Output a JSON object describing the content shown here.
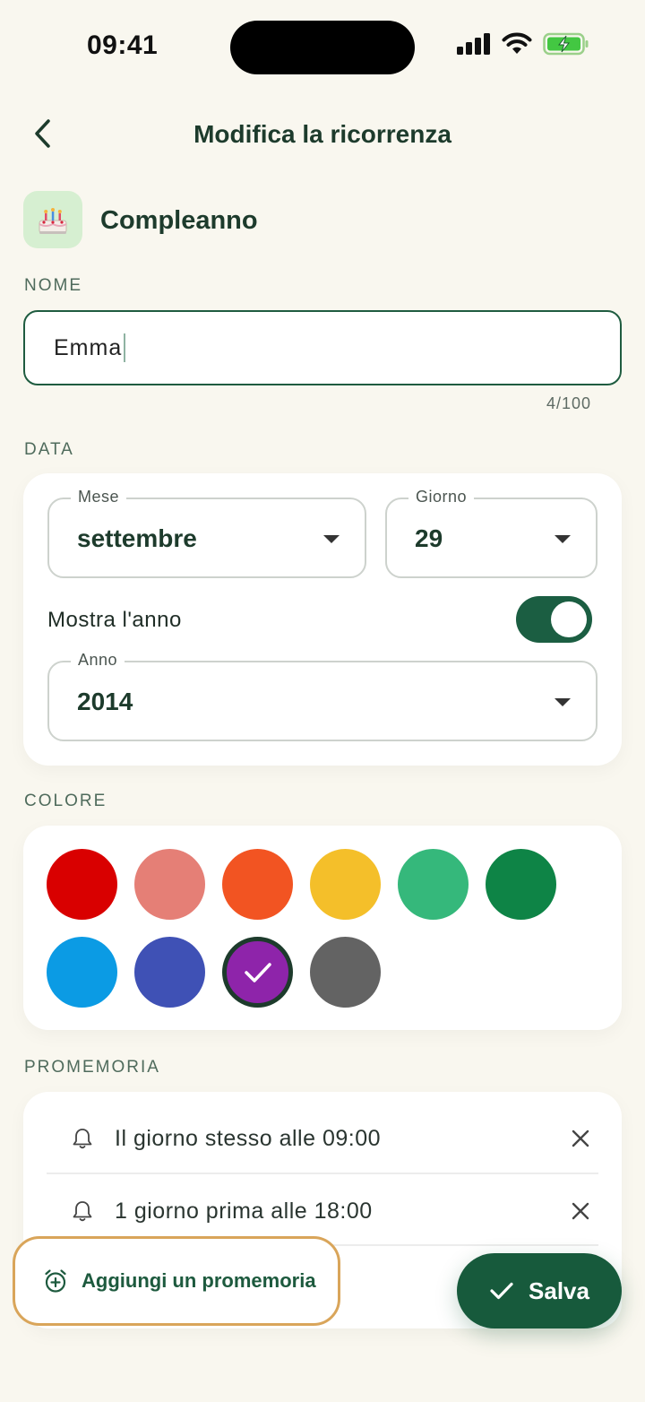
{
  "status_bar": {
    "time": "09:41"
  },
  "header": {
    "title": "Modifica la ricorrenza"
  },
  "category": {
    "label": "Compleanno",
    "icon": "birthday-cake-icon"
  },
  "name_section": {
    "label": "NOME",
    "value": "Emma",
    "char_count": "4/100"
  },
  "date_section": {
    "label": "DATA",
    "month": {
      "legend": "Mese",
      "value": "settembre"
    },
    "day": {
      "legend": "Giorno",
      "value": "29"
    },
    "show_year": {
      "label": "Mostra l'anno",
      "enabled": true
    },
    "year": {
      "legend": "Anno",
      "value": "2014"
    }
  },
  "color_section": {
    "label": "COLORE",
    "swatches": [
      {
        "name": "red",
        "hex": "#d90000"
      },
      {
        "name": "salmon",
        "hex": "#e57f76"
      },
      {
        "name": "orange",
        "hex": "#f25422"
      },
      {
        "name": "yellow",
        "hex": "#f4bf2a"
      },
      {
        "name": "mint",
        "hex": "#35b87b"
      },
      {
        "name": "green",
        "hex": "#0e8446"
      },
      {
        "name": "sky-blue",
        "hex": "#0b9be4"
      },
      {
        "name": "indigo",
        "hex": "#3f51b5"
      },
      {
        "name": "purple",
        "hex": "#8e24aa",
        "selected": true
      },
      {
        "name": "gray",
        "hex": "#636363"
      }
    ]
  },
  "reminder_section": {
    "label": "PROMEMORIA",
    "items": [
      {
        "text": "Il giorno stesso alle 09:00"
      },
      {
        "text": "1 giorno prima alle 18:00"
      }
    ],
    "add_label": "Aggiungi un promemoria"
  },
  "actions": {
    "save_label": "Salva"
  },
  "colors": {
    "accent": "#175a3c",
    "background": "#f9f7ef",
    "highlight": "#d9a55a"
  }
}
